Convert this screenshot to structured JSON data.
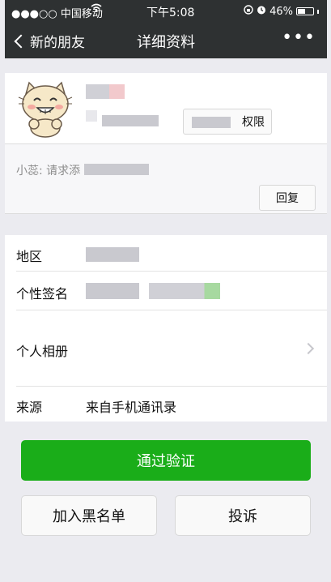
{
  "status_bar": {
    "carrier": "●●●○○ 中国移动",
    "time": "下午5:08",
    "battery": "46%"
  },
  "nav": {
    "back_label": "新的朋友",
    "title": "详细资料",
    "more_label": "•••"
  },
  "profile": {
    "permission_suffix": "权限"
  },
  "request": {
    "text_prefix": "小蕊: 请求添",
    "reply_label": "回复"
  },
  "info": {
    "region_label": "地区",
    "signature_label": "个性签名",
    "album_label": "个人相册",
    "source_label": "来源",
    "source_value": "来自手机通讯录"
  },
  "actions": {
    "approve_label": "通过验证",
    "blacklist_label": "加入黑名单",
    "report_label": "投诉"
  },
  "colors": {
    "accent_green": "#1aad19",
    "nav_bg": "#2e3132"
  }
}
